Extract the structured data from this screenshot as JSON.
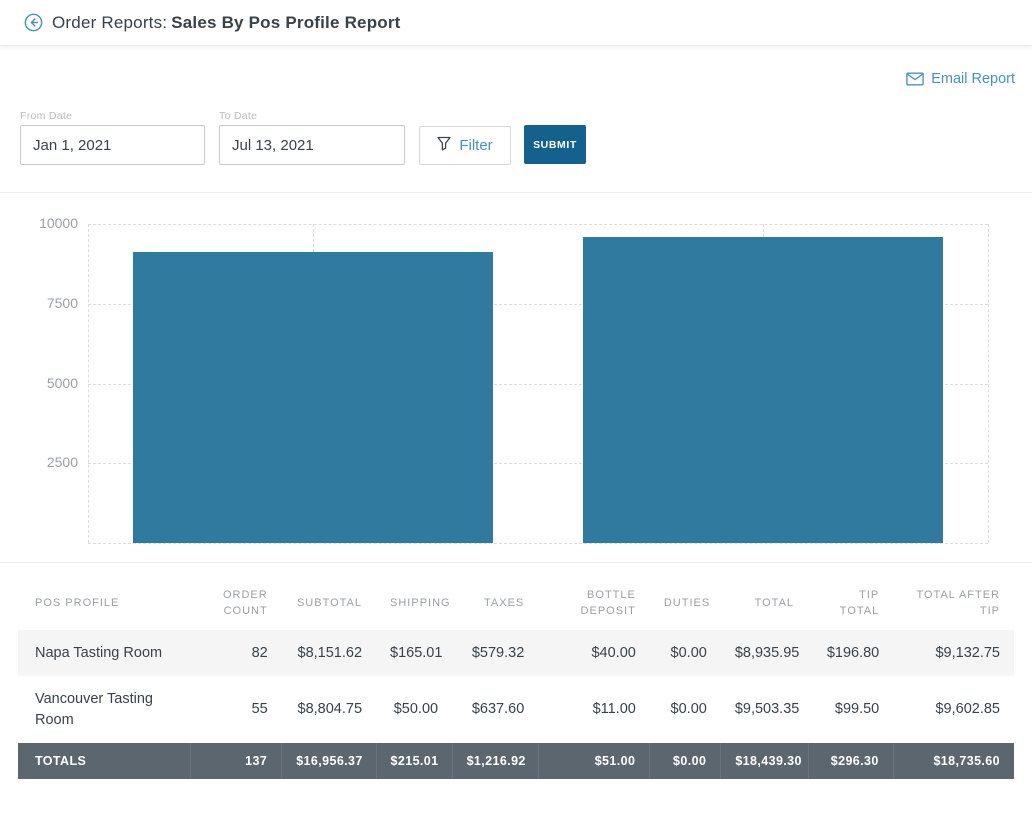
{
  "header": {
    "title_prefix": "Order Reports:",
    "title": "Sales By Pos Profile Report"
  },
  "toolbar": {
    "email_report_label": "Email Report"
  },
  "filters": {
    "from_date": {
      "label": "From Date",
      "value": "Jan 1, 2021"
    },
    "to_date": {
      "label": "To Date",
      "value": "Jul 13, 2021"
    },
    "filter_label": "Filter",
    "submit_label": "SUBMIT"
  },
  "colors": {
    "accent": "#15618e",
    "link": "#4a90c2",
    "bar": "#2f7a9e",
    "totals_bg": "#5c666f"
  },
  "chart_data": {
    "type": "bar",
    "categories": [
      "Napa Tasting Room",
      "Vancouver Tasting Room"
    ],
    "values": [
      9132.75,
      9602.85
    ],
    "series_name": "Total After Tip",
    "title": "",
    "xlabel": "",
    "ylabel": "",
    "ylim": [
      0,
      10000
    ],
    "yticks": [
      10000,
      7500,
      5000,
      2500
    ],
    "grid": "dashed",
    "legend": "none"
  },
  "table": {
    "columns": [
      "POS PROFILE",
      "ORDER COUNT",
      "SUBTOTAL",
      "SHIPPING",
      "TAXES",
      "BOTTLE DEPOSIT",
      "DUTIES",
      "TOTAL",
      "TIP TOTAL",
      "TOTAL AFTER TIP"
    ],
    "rows": [
      [
        "Napa Tasting Room",
        "82",
        "$8,151.62",
        "$165.01",
        "$579.32",
        "$40.00",
        "$0.00",
        "$8,935.95",
        "$196.80",
        "$9,132.75"
      ],
      [
        "Vancouver Tasting Room",
        "55",
        "$8,804.75",
        "$50.00",
        "$637.60",
        "$11.00",
        "$0.00",
        "$9,503.35",
        "$99.50",
        "$9,602.85"
      ]
    ],
    "totals": [
      "TOTALS",
      "137",
      "$16,956.37",
      "$215.01",
      "$1,216.92",
      "$51.00",
      "$0.00",
      "$18,439.30",
      "$296.30",
      "$18,735.60"
    ]
  }
}
